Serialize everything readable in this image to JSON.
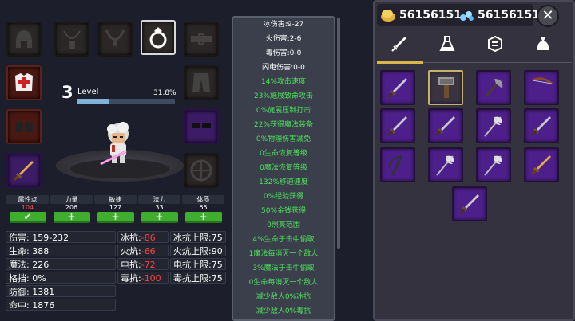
{
  "equipment": {
    "slots": [
      {
        "id": "helmet",
        "icon": "helmet-icon",
        "equipped": false
      },
      {
        "id": "amulet-1",
        "icon": "amulet-icon",
        "equipped": false
      },
      {
        "id": "amulet-2",
        "icon": "necklace-icon",
        "equipped": false
      },
      {
        "id": "ring",
        "icon": "ring-icon",
        "equipped": true
      },
      {
        "id": "belt",
        "icon": "belt-icon",
        "equipped": false
      },
      {
        "id": "armor",
        "icon": "armor-icon",
        "equipped": true
      },
      {
        "id": "pants",
        "icon": "pants-icon",
        "equipped": false
      },
      {
        "id": "gloves",
        "icon": "gloves-icon",
        "equipped": true
      },
      {
        "id": "boots",
        "icon": "boots-icon",
        "equipped": true
      },
      {
        "id": "weapon",
        "icon": "sword-icon",
        "equipped": true
      },
      {
        "id": "shield",
        "icon": "shield-icon",
        "equipped": false
      }
    ]
  },
  "level": {
    "number": "3",
    "label": "Level",
    "percent": "31.8%",
    "progress": 0.318
  },
  "attributes": [
    {
      "name": "属性点",
      "value": "104",
      "button": "✔",
      "highlight": true
    },
    {
      "name": "力量",
      "value": "206",
      "button": "+"
    },
    {
      "name": "敏捷",
      "value": "127",
      "button": "+"
    },
    {
      "name": "法力",
      "value": "33",
      "button": "+"
    },
    {
      "name": "体质",
      "value": "65",
      "button": "+"
    }
  ],
  "stats_left": [
    {
      "label": "伤害:",
      "value": "159-232"
    },
    {
      "label": "生命:",
      "value": "388"
    },
    {
      "label": "魔法:",
      "value": "226"
    },
    {
      "label": "格挡:",
      "value": "0%"
    },
    {
      "label": "防御:",
      "value": "1381"
    },
    {
      "label": "命中:",
      "value": "1876"
    }
  ],
  "stats_res": [
    {
      "label": "冰抗:",
      "value": "-86",
      "cap_label": "冰抗上限:",
      "cap": "75"
    },
    {
      "label": "火炕:",
      "value": "-66",
      "cap_label": "火炕上限:",
      "cap": "90"
    },
    {
      "label": "电抗:",
      "value": "-72",
      "cap_label": "电抗上限:",
      "cap": "75"
    },
    {
      "label": "毒抗:",
      "value": "-100",
      "cap_label": "毒抗上限:",
      "cap": "75"
    }
  ],
  "details": [
    {
      "text": "冰伤害:9-27",
      "color": "white"
    },
    {
      "text": "火伤害:2-6",
      "color": "white"
    },
    {
      "text": "毒伤害:0-0",
      "color": "white"
    },
    {
      "text": "闪电伤害:0-0",
      "color": "white"
    },
    {
      "text": "14%攻击速度",
      "color": "green"
    },
    {
      "text": "23%施展致命攻击",
      "color": "green"
    },
    {
      "text": "0%施展压制打击",
      "color": "green"
    },
    {
      "text": "22%获得魔法装备",
      "color": "green"
    },
    {
      "text": "0%物理伤害减免",
      "color": "green"
    },
    {
      "text": "0生命恢复等级",
      "color": "green"
    },
    {
      "text": "0魔法恢复等级",
      "color": "green"
    },
    {
      "text": "132%移速速度",
      "color": "green"
    },
    {
      "text": "0%经验获得",
      "color": "green"
    },
    {
      "text": "50%金钱获得",
      "color": "green"
    },
    {
      "text": "0照亮范围",
      "color": "green"
    },
    {
      "text": "4%生命于击中偷取",
      "color": "green"
    },
    {
      "text": "1魔法每消灭一个敌人",
      "color": "green"
    },
    {
      "text": "3%魔法于击中偷取",
      "color": "green"
    },
    {
      "text": "0生命每消灭一个敌人",
      "color": "green"
    },
    {
      "text": "减少敌人0%冰抗",
      "color": "green"
    },
    {
      "text": "减少敌人0%毒抗",
      "color": "green"
    },
    {
      "text": "减少敌人0%火抗",
      "color": "green"
    }
  ],
  "currency": {
    "gold": "56156151",
    "gems": "56156151",
    "close": "✕"
  },
  "tabs": [
    {
      "id": "weapons",
      "icon": "sword-tab-icon",
      "active": true
    },
    {
      "id": "potions",
      "icon": "potion-tab-icon",
      "active": false
    },
    {
      "id": "gems",
      "icon": "gem-tab-icon",
      "active": false
    },
    {
      "id": "bags",
      "icon": "bag-tab-icon",
      "active": false
    }
  ],
  "inventory": [
    {
      "icon": "sword-icon",
      "selected": false
    },
    {
      "icon": "hammer-icon",
      "selected": true
    },
    {
      "icon": "axe-icon",
      "selected": false
    },
    {
      "icon": "bow-icon",
      "selected": false
    },
    {
      "icon": "sword-icon",
      "selected": false
    },
    {
      "icon": "sword-icon",
      "selected": false
    },
    {
      "icon": "double-axe-icon",
      "selected": false
    },
    {
      "icon": "sword-icon",
      "selected": false
    },
    {
      "icon": "scythe-icon",
      "selected": false
    },
    {
      "icon": "double-axe-icon",
      "selected": false
    },
    {
      "icon": "double-axe-icon",
      "selected": false
    },
    {
      "icon": "gold-sword-icon",
      "selected": false
    },
    {
      "icon": "sword-icon",
      "selected": false
    }
  ],
  "colors": {
    "accent": "#d9b54a",
    "item_bg": "#4d1f8a",
    "positive": "#4ce05a",
    "negative": "#ff4040",
    "button": "#3fae2e"
  }
}
